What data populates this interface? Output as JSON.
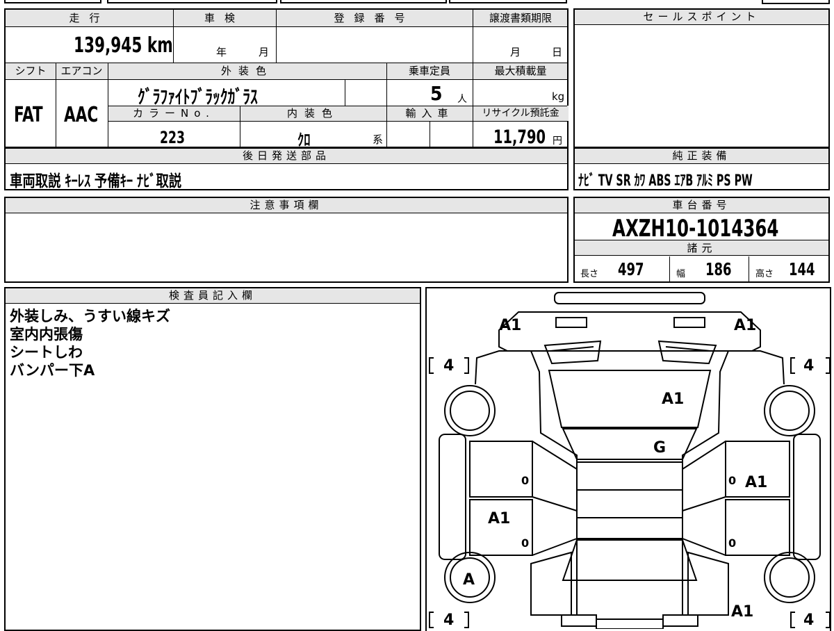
{
  "mileage": {
    "label": "走行",
    "value": "139,945",
    "unit": "km"
  },
  "shaken": {
    "label": "車検",
    "year": "年",
    "month": "月"
  },
  "registration": {
    "label": "登録番号",
    "value": ""
  },
  "transfer": {
    "label": "譲渡書類期限",
    "month": "月",
    "day": "日"
  },
  "sales_point": {
    "label": "セールスポイント"
  },
  "shift": {
    "label": "シフト",
    "value": "FAT"
  },
  "aircon": {
    "label": "エアコン",
    "value": "AAC"
  },
  "exterior_color": {
    "label": "外装色",
    "value": "ｸﾞﾗﾌｧｲﾄﾌﾞﾗｯｸｶﾞﾗｽ"
  },
  "capacity": {
    "label": "乗車定員",
    "value": "5",
    "unit": "人"
  },
  "max_load": {
    "label": "最大積載量",
    "unit": "kg"
  },
  "color_no": {
    "label": "カラーNo.",
    "value": "223"
  },
  "interior_color": {
    "label": "内装色",
    "value": "ｸﾛ",
    "suffix": "系"
  },
  "import": {
    "label": "輸入車"
  },
  "recycle": {
    "label": "リサイクル預託金",
    "value": "11,790",
    "unit": "円"
  },
  "shipping_parts": {
    "label": "後日発送部品",
    "value": "車両取説 ｷｰﾚｽ 予備ｷｰ ﾅﾋﾞ取説"
  },
  "genuine_equipment": {
    "label": "純正装備",
    "value": "ﾅﾋﾞ TV SR ｶﾜ ABS ｴｱB ｱﾙﾐ PS PW"
  },
  "caution": {
    "label": "注意事項欄"
  },
  "chassis": {
    "label": "車台番号",
    "value": "AXZH10-1014364"
  },
  "specs": {
    "label": "諸元",
    "length_label": "長さ",
    "length": "497",
    "width_label": "幅",
    "width": "186",
    "height_label": "高さ",
    "height": "144"
  },
  "inspector": {
    "label": "検査員記入欄",
    "lines": [
      "外装しみ、うすい線キズ",
      "室内内張傷",
      "シートしわ",
      "バンパー下A"
    ]
  },
  "diagram": {
    "tire_fl": "4",
    "tire_fr": "4",
    "tire_rl": "4",
    "tire_rr": "4",
    "front_left": "A1",
    "front_right": "A1",
    "hood": "A1",
    "windshield": "G",
    "right_fender": "A1",
    "left_door": "A1",
    "left_rear_wheel": "A",
    "rear_right": "A1",
    "zero1": "0",
    "zero2": "0",
    "zero3": "0",
    "zero4": "0"
  }
}
